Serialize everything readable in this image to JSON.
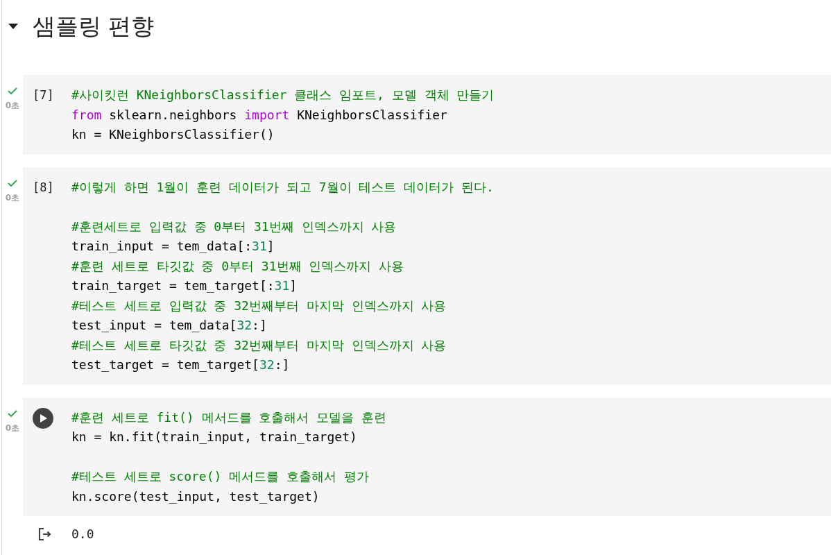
{
  "section": {
    "title": "샘플링 편향",
    "expanded": true
  },
  "cells": [
    {
      "kind": "numbered",
      "count": "[7]",
      "succeeded": true,
      "time": "0초",
      "lines": [
        {
          "kind": "code",
          "tokens": [
            {
              "kind": "comment",
              "text": "#사이킷런 KNeighborsClassifier 클래스 임포트, 모델 객체 만들기"
            }
          ]
        },
        {
          "kind": "code",
          "tokens": [
            {
              "kind": "keyword",
              "text": "from"
            },
            {
              "kind": "plain",
              "text": " sklearn.neighbors "
            },
            {
              "kind": "keyword",
              "text": "import"
            },
            {
              "kind": "plain",
              "text": " KNeighborsClassifier"
            }
          ]
        },
        {
          "kind": "code",
          "tokens": [
            {
              "kind": "plain",
              "text": "kn = KNeighborsClassifier()"
            }
          ]
        }
      ]
    },
    {
      "kind": "numbered",
      "count": "[8]",
      "succeeded": true,
      "time": "0초",
      "lines": [
        {
          "kind": "code",
          "tokens": [
            {
              "kind": "comment",
              "text": "#이렇게 하면 1월이 훈련 데이터가 되고 7월이 테스트 데이터가 된다."
            }
          ]
        },
        {
          "kind": "blank"
        },
        {
          "kind": "code",
          "tokens": [
            {
              "kind": "comment",
              "text": "#훈련세트로 입력값 중 0부터 31번째 인덱스까지 사용"
            }
          ]
        },
        {
          "kind": "code",
          "tokens": [
            {
              "kind": "plain",
              "text": "train_input = tem_data[:"
            },
            {
              "kind": "number",
              "text": "31"
            },
            {
              "kind": "plain",
              "text": "]"
            }
          ]
        },
        {
          "kind": "code",
          "tokens": [
            {
              "kind": "comment",
              "text": "#훈련 세트로 타깃값 중 0부터 31번째 인덱스까지 사용"
            }
          ]
        },
        {
          "kind": "code",
          "tokens": [
            {
              "kind": "plain",
              "text": "train_target = tem_target[:"
            },
            {
              "kind": "number",
              "text": "31"
            },
            {
              "kind": "plain",
              "text": "]"
            }
          ]
        },
        {
          "kind": "code",
          "tokens": [
            {
              "kind": "comment",
              "text": "#테스트 세트로 입력값 중 32번째부터 마지막 인덱스까지 사용"
            }
          ]
        },
        {
          "kind": "code",
          "tokens": [
            {
              "kind": "plain",
              "text": "test_input = tem_data["
            },
            {
              "kind": "number",
              "text": "32"
            },
            {
              "kind": "plain",
              "text": ":]"
            }
          ]
        },
        {
          "kind": "code",
          "tokens": [
            {
              "kind": "comment",
              "text": "#테스트 세트로 타깃값 중 32번째부터 마지막 인덱스까지 사용"
            }
          ]
        },
        {
          "kind": "code",
          "tokens": [
            {
              "kind": "plain",
              "text": "test_target = tem_target["
            },
            {
              "kind": "number",
              "text": "32"
            },
            {
              "kind": "plain",
              "text": ":]"
            }
          ]
        }
      ]
    },
    {
      "kind": "run",
      "succeeded": true,
      "time": "0초",
      "lines": [
        {
          "kind": "code",
          "tokens": [
            {
              "kind": "comment",
              "text": "#훈련 세트로 fit() 메서드를 호출해서 모델을 훈련"
            }
          ]
        },
        {
          "kind": "code",
          "tokens": [
            {
              "kind": "plain",
              "text": "kn = kn.fit(train_input, train_target)"
            }
          ]
        },
        {
          "kind": "blank"
        },
        {
          "kind": "code",
          "tokens": [
            {
              "kind": "comment",
              "text": "#테스트 세트로 score() 메서드를 호출해서 평가"
            }
          ]
        },
        {
          "kind": "code",
          "tokens": [
            {
              "kind": "plain",
              "text": "kn.score(test_input, test_target)"
            }
          ]
        }
      ],
      "output": {
        "text": "0.0"
      }
    }
  ]
}
